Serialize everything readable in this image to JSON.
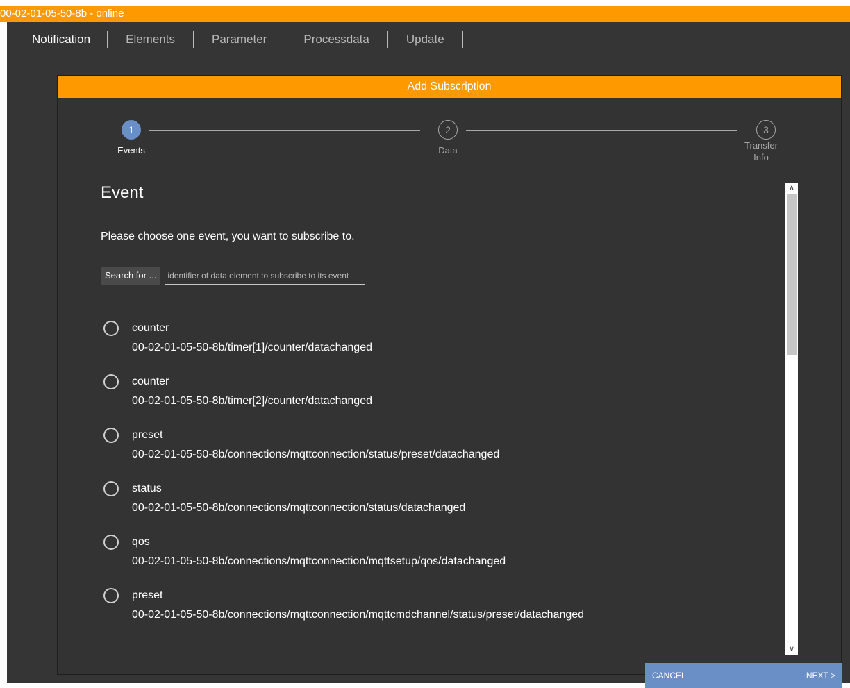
{
  "window": {
    "title": "00-02-01-05-50-8b - online"
  },
  "nav": {
    "tabs": [
      {
        "label": "Notification"
      },
      {
        "label": "Elements"
      },
      {
        "label": "Parameter"
      },
      {
        "label": "Processdata"
      },
      {
        "label": "Update"
      }
    ],
    "active": "Notification"
  },
  "dialog": {
    "title": "Add Subscription",
    "steps": [
      {
        "number": "1",
        "label": "Events"
      },
      {
        "number": "2",
        "label": "Data"
      },
      {
        "number": "3",
        "label": "Transfer Info"
      }
    ],
    "current_step": 1,
    "section_title": "Event",
    "description": "Please choose one event, you want to subscribe to.",
    "search": {
      "label": "Search for ...",
      "placeholder": "identifier of data element to subscribe to its event"
    },
    "events": [
      {
        "name": "counter",
        "path": "00-02-01-05-50-8b/timer[1]/counter/datachanged"
      },
      {
        "name": "counter",
        "path": "00-02-01-05-50-8b/timer[2]/counter/datachanged"
      },
      {
        "name": "preset",
        "path": "00-02-01-05-50-8b/connections/mqttconnection/status/preset/datachanged"
      },
      {
        "name": "status",
        "path": "00-02-01-05-50-8b/connections/mqttconnection/status/datachanged"
      },
      {
        "name": "qos",
        "path": "00-02-01-05-50-8b/connections/mqttconnection/mqttsetup/qos/datachanged"
      },
      {
        "name": "preset",
        "path": "00-02-01-05-50-8b/connections/mqttconnection/mqttcmdchannel/status/preset/datachanged"
      }
    ],
    "buttons": {
      "cancel": "CANCEL",
      "next": "NEXT >"
    }
  },
  "colors": {
    "accent": "#ff9900",
    "primary": "#6a8fc6",
    "background": "#353535"
  }
}
